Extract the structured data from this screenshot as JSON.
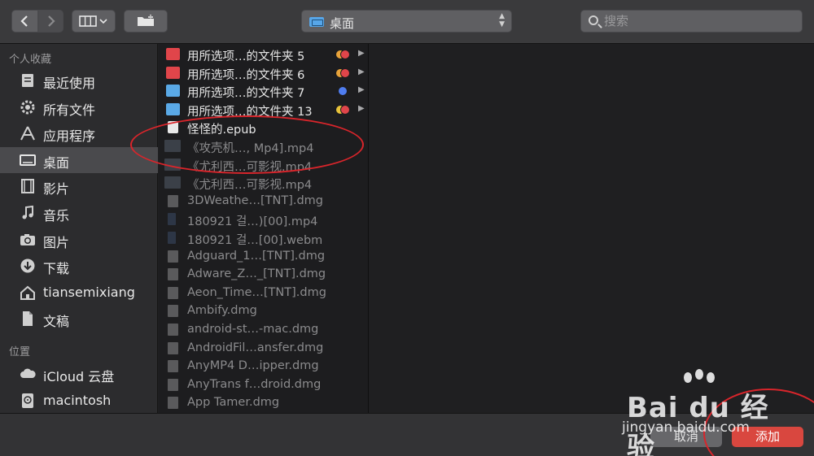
{
  "toolbar": {
    "location_label": "桌面",
    "search_placeholder": "搜索"
  },
  "sidebar": {
    "favorites_header": "个人收藏",
    "locations_header": "位置",
    "favorites": [
      {
        "label": "最近使用",
        "icon": "recents-icon"
      },
      {
        "label": "所有文件",
        "icon": "gear-icon"
      },
      {
        "label": "应用程序",
        "icon": "applications-icon"
      },
      {
        "label": "桌面",
        "icon": "desktop-icon",
        "selected": true
      },
      {
        "label": "影片",
        "icon": "movies-icon"
      },
      {
        "label": "音乐",
        "icon": "music-icon"
      },
      {
        "label": "图片",
        "icon": "camera-icon"
      },
      {
        "label": "下载",
        "icon": "download-icon"
      },
      {
        "label": "tiansemixiang",
        "icon": "home-icon"
      },
      {
        "label": "文稿",
        "icon": "documents-icon"
      }
    ],
    "locations": [
      {
        "label": "iCloud 云盘",
        "icon": "cloud-icon"
      },
      {
        "label": "macintosh",
        "icon": "disk-icon"
      }
    ]
  },
  "files": [
    {
      "name": "用所选项…的文件夹 5",
      "icon": "folder-icon",
      "icon_color": "#e0454a",
      "tags": [
        "#e8a33a",
        "#e0454a"
      ],
      "disclosure": true,
      "dim": false
    },
    {
      "name": "用所选项…的文件夹 6",
      "icon": "folder-icon",
      "icon_color": "#e0454a",
      "tags": [
        "#e8a33a",
        "#e0454a"
      ],
      "disclosure": true,
      "dim": false
    },
    {
      "name": "用所选项…的文件夹 7",
      "icon": "folder-icon",
      "icon_color": "#5aa9e6",
      "tags": [
        "#4f7df0"
      ],
      "disclosure": true,
      "dim": false
    },
    {
      "name": "用所选项…的文件夹 13",
      "icon": "folder-icon",
      "icon_color": "#5aa9e6",
      "tags": [
        "#e8c33a",
        "#e0454a"
      ],
      "disclosure": true,
      "dim": false
    },
    {
      "name": "怪怪的.epub",
      "icon": "epub-icon",
      "dim": false
    },
    {
      "name": "《攻壳机…, Mp4].mp4",
      "icon": "video-icon",
      "dim": true
    },
    {
      "name": "《尤利西…可影视.mp4",
      "icon": "video-icon",
      "dim": true
    },
    {
      "name": "《尤利西…可影视.mp4",
      "icon": "video-icon",
      "dim": true
    },
    {
      "name": "3DWeathe…[TNT].dmg",
      "icon": "document-icon",
      "dim": true
    },
    {
      "name": "180921 걸…)[00].mp4",
      "icon": "video-thin-icon",
      "dim": true
    },
    {
      "name": "180921 걸…[00].webm",
      "icon": "video-thin-icon",
      "dim": true
    },
    {
      "name": "Adguard_1…[TNT].dmg",
      "icon": "document-icon",
      "dim": true
    },
    {
      "name": "Adware_Z…_[TNT].dmg",
      "icon": "document-icon",
      "dim": true
    },
    {
      "name": "Aeon_Time…[TNT].dmg",
      "icon": "document-icon",
      "dim": true
    },
    {
      "name": "Ambify.dmg",
      "icon": "document-icon",
      "dim": true
    },
    {
      "name": "android-st…-mac.dmg",
      "icon": "document-icon",
      "dim": true
    },
    {
      "name": "AndroidFil…ansfer.dmg",
      "icon": "document-icon",
      "dim": true
    },
    {
      "name": "AnyMP4 D…ipper.dmg",
      "icon": "document-icon",
      "dim": true
    },
    {
      "name": "AnyTrans f…droid.dmg",
      "icon": "document-icon",
      "dim": true
    },
    {
      "name": "App Tamer.dmg",
      "icon": "document-icon",
      "dim": true
    }
  ],
  "buttons": {
    "cancel": "取消",
    "add": "添加"
  },
  "watermark": {
    "logo": "Bai du 经验",
    "url": "jingyan.baidu.com"
  },
  "colors": {
    "accent_add": "#d9473f",
    "annotation_red": "#d9252b"
  }
}
